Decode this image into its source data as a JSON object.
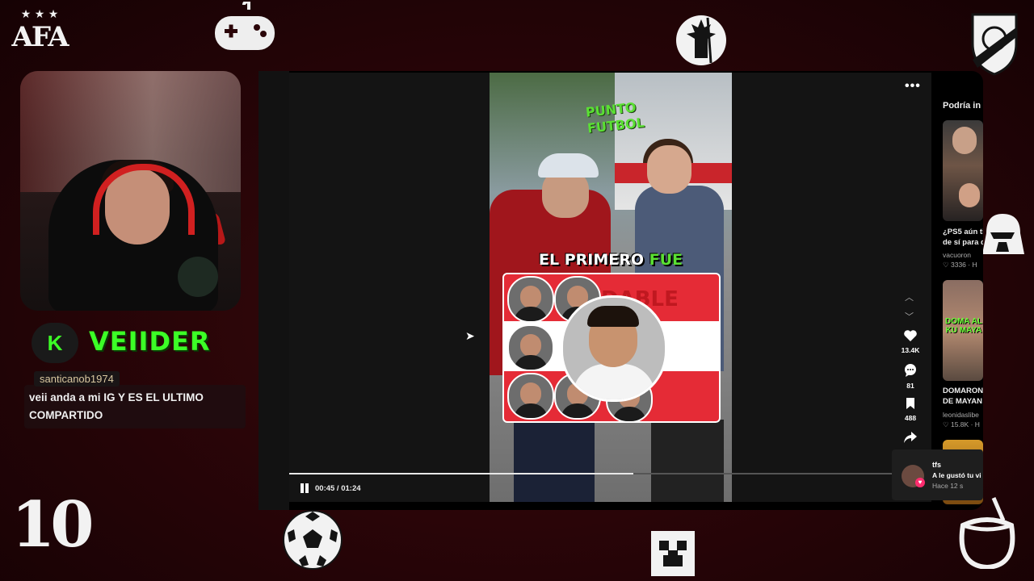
{
  "overlay": {
    "afa_text": "AFA",
    "afa_stars": "★ ★ ★",
    "shirt_number": "10",
    "streamer_name": "VEIIDER",
    "streamer_logo_letter": "K",
    "accent_green": "#3cff26",
    "icons": [
      "gamepad-icon",
      "goku-silhouette-icon",
      "river-plate-crest-icon",
      "darth-vader-icon",
      "soccer-ball-icon",
      "creeper-icon",
      "mate-gourd-icon"
    ]
  },
  "chat": {
    "username": "santicanob1974",
    "message": "veii anda a mi IG Y ES EL ULTIMO COMPARTIDO"
  },
  "video": {
    "brand_line1": "PUNTO",
    "brand_line2": "FUTBOL",
    "caption_part1": "EL PRIMERO ",
    "caption_highlight": "FUE",
    "graphic_word": "DABLE",
    "time": "00:45 / 01:24",
    "progress": 0.536
  },
  "actions": {
    "likes": "13.4K",
    "comments": "81",
    "saves": "488"
  },
  "recommendations": {
    "title": "Podría in",
    "items": [
      {
        "title": "¿PS5 aún ti",
        "title2": "de sí para d",
        "author": "vacuoron",
        "likes": "3336",
        "suffix": "· H"
      },
      {
        "title": "DOMARON",
        "title2": "DE MAYAN",
        "author": "leonidaslibe",
        "likes": "15.8K",
        "suffix": "· H",
        "thumb_text": "DOMA AL KU MAYA"
      }
    ]
  },
  "notification": {
    "user": "tfs",
    "text": "A le gustó tu vi",
    "time": "Hace 12 s"
  }
}
